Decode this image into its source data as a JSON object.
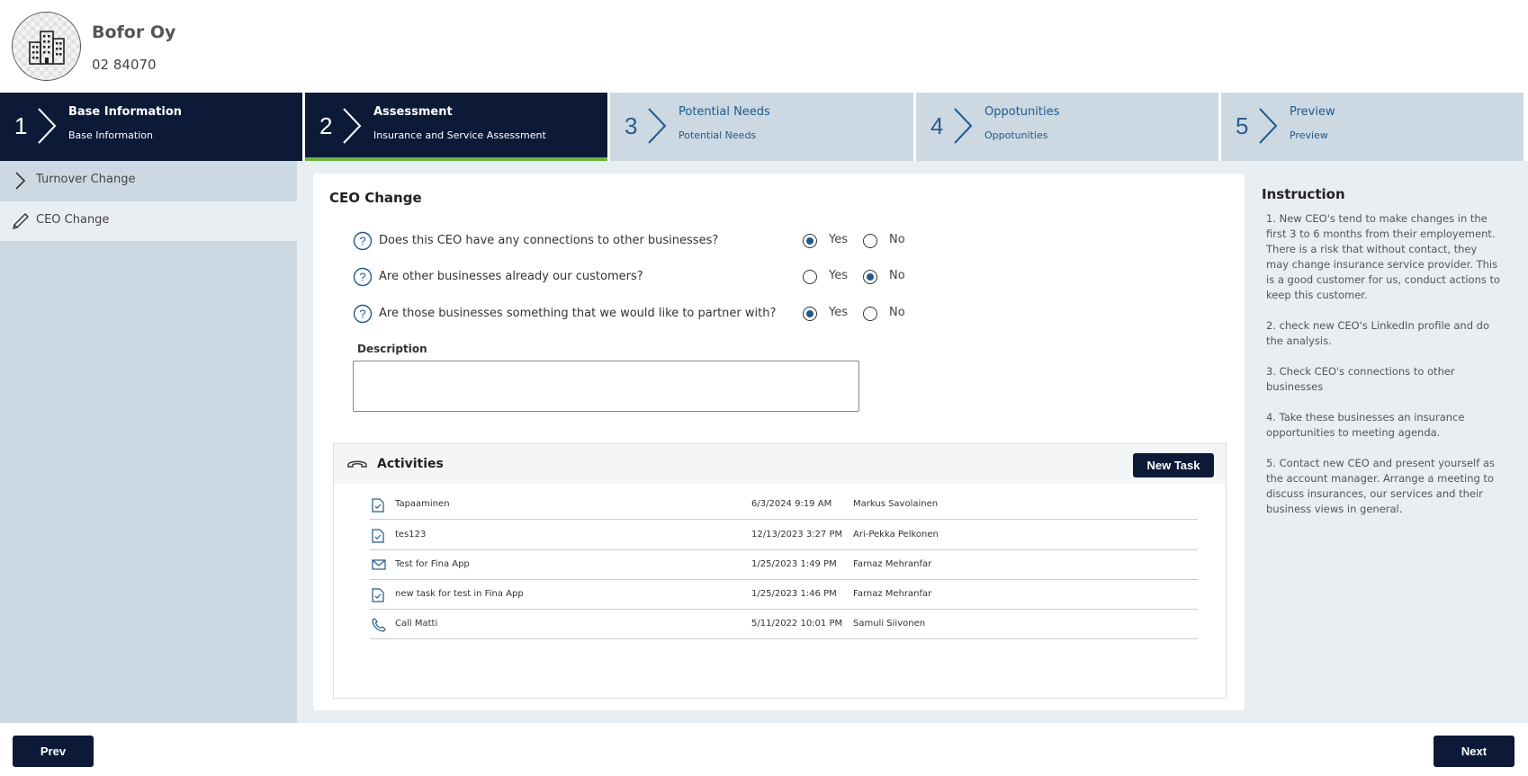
{
  "company": {
    "name": "Bofor Oy",
    "id": "02 84070",
    "avatar_icon": "building-icon"
  },
  "steps": [
    {
      "num": "1",
      "title": "Base Information",
      "sub": "Base Information",
      "state": "done"
    },
    {
      "num": "2",
      "title": "Assessment",
      "sub": "Insurance and Service Assessment",
      "state": "active"
    },
    {
      "num": "3",
      "title": "Potential Needs",
      "sub": "Potential Needs",
      "state": "todo"
    },
    {
      "num": "4",
      "title": "Oppotunities",
      "sub": "Oppotunities",
      "state": "todo"
    },
    {
      "num": "5",
      "title": "Preview",
      "sub": "Preview",
      "state": "todo"
    }
  ],
  "sidebar": {
    "items": [
      {
        "label": "Turnover Change",
        "icon": "chevron-right-icon"
      },
      {
        "label": "CEO Change",
        "icon": "pencil-icon"
      }
    ]
  },
  "form": {
    "title": "CEO Change",
    "questions": [
      {
        "text": "Does this CEO have any connections to other businesses?",
        "yes": "Yes",
        "no": "No",
        "selected": "Yes"
      },
      {
        "text": "Are other businesses already our customers?",
        "yes": "Yes",
        "no": "No",
        "selected": "No"
      },
      {
        "text": "Are those businesses something that we would like to partner with?",
        "yes": "Yes",
        "no": "No",
        "selected": "Yes"
      }
    ],
    "description_label": "Description",
    "description_value": ""
  },
  "activities": {
    "title": "Activities",
    "new_task_label": "New Task",
    "rows": [
      {
        "icon": "task-icon",
        "name": "Tapaaminen",
        "date": "6/3/2024 9:19 AM",
        "owner": "Markus Savolainen"
      },
      {
        "icon": "task-icon",
        "name": "tes123",
        "date": "12/13/2023 3:27 PM",
        "owner": "Ari-Pekka Pelkonen"
      },
      {
        "icon": "mail-icon",
        "name": "Test for Fina App",
        "date": "1/25/2023 1:49 PM",
        "owner": "Farnaz Mehranfar"
      },
      {
        "icon": "task-icon",
        "name": "new task for test in Fina App",
        "date": "1/25/2023 1:46 PM",
        "owner": "Farnaz Mehranfar"
      },
      {
        "icon": "phone-icon",
        "name": "Call Matti",
        "date": "5/11/2022 10:01 PM",
        "owner": "Samuli Siivonen"
      }
    ]
  },
  "instruction": {
    "title": "Instruction",
    "items": [
      "1. New CEO's tend to make changes in the first 3 to 6 months from their employement. There is a risk that without contact, they may change insurance service provider. This is a good customer for us, conduct actions to keep this customer.",
      "2. check new CEO's LinkedIn profile and do the analysis.",
      "3. Check CEO's connections to other businesses",
      "4. Take these businesses an insurance opportunities to meeting agenda.",
      "5. Contact new CEO and present yourself as the account manager. Arrange a meeting to discuss insurances, our services and their business views in general."
    ]
  },
  "footer": {
    "prev_label": "Prev",
    "next_label": "Next"
  },
  "colors": {
    "navy": "#0c1a38",
    "accent_green": "#6cb33f",
    "step_blue": "#1f5a8e",
    "panel": "#ccd8e2"
  }
}
